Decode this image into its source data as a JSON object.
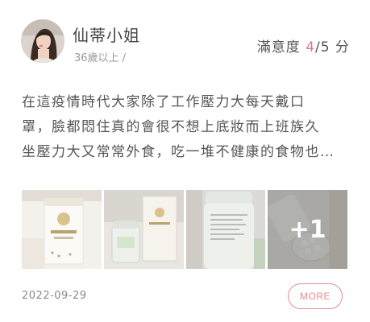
{
  "review": {
    "user": {
      "name": "仙蒂小姐",
      "meta": "36歲以上 /"
    },
    "rating": {
      "label": "滿意度",
      "score": "4",
      "max": "/5",
      "unit": "分",
      "value": 4,
      "out_of": 5
    },
    "text_lines": [
      "在這疫情時代大家除了工作壓力大每天戴口",
      "罩，臉都悶住真的會很不想上底妝而上班族久",
      "坐壓力大又常常外食，吃一堆不健康的食物也…"
    ],
    "photos": {
      "extra_count": "+1"
    },
    "date": "2022-09-29",
    "more_label": "MORE"
  },
  "colors": {
    "accent": "#e6767e",
    "button_border": "#e88a8f"
  }
}
